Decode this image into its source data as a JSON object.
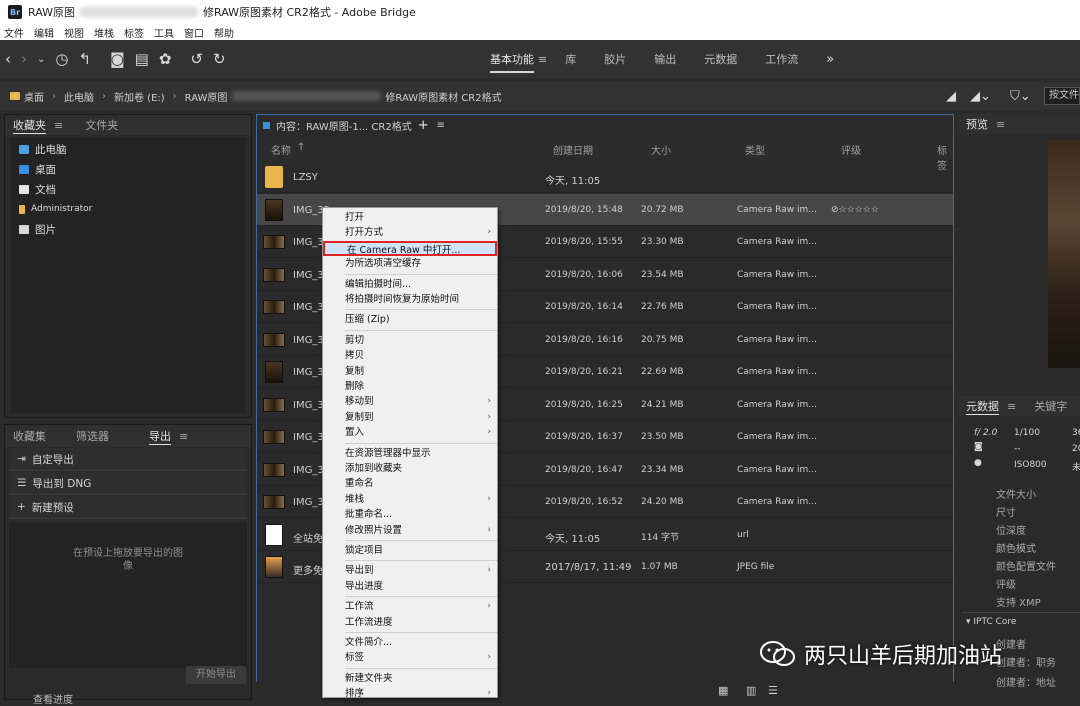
{
  "window": {
    "title_prefix": "RAW原图",
    "title_suffix": "修RAW原图素材 CR2格式 - Adobe Bridge",
    "app_badge": "Br"
  },
  "menus": [
    "文件",
    "编辑",
    "视图",
    "堆栈",
    "标签",
    "工具",
    "窗口",
    "帮助"
  ],
  "workspaces": [
    "基本功能",
    "库",
    "胶片",
    "输出",
    "元数据",
    "工作流"
  ],
  "workspace_menu_glyph": "≡",
  "workspace_more": "»",
  "path": {
    "items": [
      "桌面",
      "此电脑",
      "新加卷 (E:)",
      "RAW原图"
    ],
    "tail": "修RAW原图素材 CR2格式",
    "search_placeholder": "按文件"
  },
  "left_top": {
    "tabs": [
      "收藏夹",
      "文件夹"
    ],
    "tab_menu": "≡",
    "items": [
      {
        "label": "此电脑",
        "color": "#4aa3e0"
      },
      {
        "label": "桌面",
        "color": "#3a8ee0"
      },
      {
        "label": "文档",
        "color": "#e8e8e8"
      },
      {
        "label": "Administrator",
        "color": "#e8b64c"
      },
      {
        "label": "图片",
        "color": "#d8d8d8"
      }
    ]
  },
  "left_bottom": {
    "tabs": [
      "收藏集",
      "筛选器",
      "导出"
    ],
    "tab_menu": "≡",
    "items": [
      "自定导出",
      "导出到 DNG",
      "新建预设"
    ],
    "drop_hint_line1": "在预设上拖放要导出的图",
    "drop_hint_line2": "像",
    "start_export": "开始导出",
    "progress_label": "查看进度"
  },
  "content": {
    "header": "内容：RAW原图-1... CR2格式",
    "plus": "+",
    "menu": "≡",
    "columns": [
      "名称",
      "创建日期",
      "大小",
      "类型",
      "评级",
      "标签"
    ],
    "sort_arrow": "↑",
    "rows": [
      {
        "name": "LZSY",
        "date": "今天, 11:05",
        "size": "",
        "type": "",
        "rating": "",
        "kind": "folder"
      },
      {
        "name": "IMG_32",
        "date": "2019/8/20, 15:48",
        "size": "20.72 MB",
        "type": "Camera Raw im...",
        "rating": "⊘☆☆☆☆☆",
        "kind": "photo",
        "selected": true
      },
      {
        "name": "IMG_33",
        "date": "2019/8/20, 15:55",
        "size": "23.30 MB",
        "type": "Camera Raw im...",
        "rating": "",
        "kind": "wide"
      },
      {
        "name": "IMG_33",
        "date": "2019/8/20, 16:06",
        "size": "23.54 MB",
        "type": "Camera Raw im...",
        "rating": "",
        "kind": "wide"
      },
      {
        "name": "IMG_33",
        "date": "2019/8/20, 16:14",
        "size": "22.76 MB",
        "type": "Camera Raw im...",
        "rating": "",
        "kind": "wide"
      },
      {
        "name": "IMG_33",
        "date": "2019/8/20, 16:16",
        "size": "20.75 MB",
        "type": "Camera Raw im...",
        "rating": "",
        "kind": "wide"
      },
      {
        "name": "IMG_33",
        "date": "2019/8/20, 16:21",
        "size": "22.69 MB",
        "type": "Camera Raw im...",
        "rating": "",
        "kind": "photo"
      },
      {
        "name": "IMG_33",
        "date": "2019/8/20, 16:25",
        "size": "24.21 MB",
        "type": "Camera Raw im...",
        "rating": "",
        "kind": "wide"
      },
      {
        "name": "IMG_33",
        "date": "2019/8/20, 16:37",
        "size": "23.50 MB",
        "type": "Camera Raw im...",
        "rating": "",
        "kind": "wide"
      },
      {
        "name": "IMG_33",
        "date": "2019/8/20, 16:47",
        "size": "23.34 MB",
        "type": "Camera Raw im...",
        "rating": "",
        "kind": "wide"
      },
      {
        "name": "IMG_33",
        "date": "2019/8/20, 16:52",
        "size": "24.20 MB",
        "type": "Camera Raw im...",
        "rating": "",
        "kind": "wide"
      },
      {
        "name": "全站免",
        "date": "今天, 11:05",
        "size": "114 字节",
        "type": "url",
        "rating": "",
        "kind": "url"
      },
      {
        "name": "更多免",
        "date": "2017/8/17, 11:49",
        "size": "1.07 MB",
        "type": "JPEG file",
        "rating": "",
        "kind": "jpeg"
      }
    ]
  },
  "context_menu": {
    "items": [
      {
        "label": "打开",
        "arrow": false
      },
      {
        "label": "打开方式",
        "arrow": true
      },
      {
        "label": "在 Camera Raw 中打开...",
        "arrow": false,
        "highlight": true
      },
      {
        "label": "为所选项清空缓存",
        "arrow": false,
        "sep_after": true
      },
      {
        "label": "编辑拍摄时间...",
        "arrow": false
      },
      {
        "label": "将拍摄时间恢复为原始时间",
        "arrow": false,
        "sep_after": true
      },
      {
        "label": "压缩 (Zip)",
        "arrow": false,
        "sep_after": true
      },
      {
        "label": "剪切",
        "arrow": false
      },
      {
        "label": "拷贝",
        "arrow": false
      },
      {
        "label": "复制",
        "arrow": false
      },
      {
        "label": "删除",
        "arrow": false
      },
      {
        "label": "移动到",
        "arrow": true
      },
      {
        "label": "复制到",
        "arrow": true
      },
      {
        "label": "置入",
        "arrow": true,
        "sep_after": true
      },
      {
        "label": "在资源管理器中显示",
        "arrow": false
      },
      {
        "label": "添加到收藏夹",
        "arrow": false
      },
      {
        "label": "重命名",
        "arrow": false
      },
      {
        "label": "堆栈",
        "arrow": true
      },
      {
        "label": "批重命名...",
        "arrow": false
      },
      {
        "label": "修改照片设置",
        "arrow": true,
        "sep_after": true
      },
      {
        "label": "锁定项目",
        "arrow": false,
        "sep_after": true
      },
      {
        "label": "导出到",
        "arrow": true
      },
      {
        "label": "导出进度",
        "arrow": false,
        "sep_after": true
      },
      {
        "label": "工作流",
        "arrow": true
      },
      {
        "label": "工作流进度",
        "arrow": false,
        "sep_after": true
      },
      {
        "label": "文件简介...",
        "arrow": false
      },
      {
        "label": "标签",
        "arrow": true,
        "sep_after": true
      },
      {
        "label": "新建文件夹",
        "arrow": false
      },
      {
        "label": "排序",
        "arrow": true
      }
    ]
  },
  "preview": {
    "title": "预览",
    "menu": "≡"
  },
  "metadata": {
    "tabs": [
      "元数据",
      "关键字"
    ],
    "menu": "≡",
    "camera": {
      "aperture": "f/ 2.0",
      "shutter": "1/100",
      "ev": "--",
      "iso": "ISO800",
      "c1": "36",
      "c2": "20",
      "c3": "未"
    },
    "fields": [
      "文件大小",
      "尺寸",
      "位深度",
      "颜色模式",
      "颜色配置文件",
      "评级",
      "支持 XMP"
    ],
    "section": "IPTC Core",
    "iptc_items": [
      "创建者",
      "创建者：职务",
      "创建者：地址"
    ]
  },
  "watermark": "两只山羊后期加油站"
}
